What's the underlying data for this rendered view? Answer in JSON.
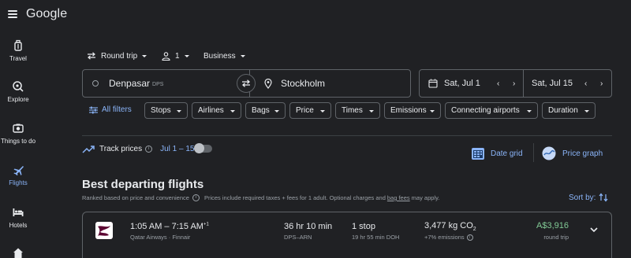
{
  "header": {
    "brand": "Google"
  },
  "nav": [
    {
      "label": "Travel",
      "icon": "suitcase-icon"
    },
    {
      "label": "Explore",
      "icon": "explore-icon"
    },
    {
      "label": "Things to do",
      "icon": "camera-icon"
    },
    {
      "label": "Flights",
      "icon": "plane-icon",
      "active": true
    },
    {
      "label": "Hotels",
      "icon": "bed-icon"
    }
  ],
  "trip": {
    "type": "Round trip",
    "passengers": "1",
    "cabin": "Business"
  },
  "search": {
    "origin": "Denpasar",
    "origin_code": "DPS",
    "destination": "Stockholm",
    "depart": "Sat, Jul 1",
    "return": "Sat, Jul 15"
  },
  "filters": {
    "all_label": "All filters",
    "chips": [
      "Stops",
      "Airlines",
      "Bags",
      "Price",
      "Times",
      "Emissions",
      "Connecting airports",
      "Duration"
    ]
  },
  "track": {
    "label": "Track prices",
    "range": "Jul 1 – 15",
    "enabled": false
  },
  "views": {
    "date_grid": "Date grid",
    "price_graph": "Price graph"
  },
  "results": {
    "heading": "Best departing flights",
    "ranked_note": "Ranked based on price and convenience",
    "price_note_pre": "Prices include required taxes + fees for 1 adult. Optional charges and",
    "price_note_link": "bag fees",
    "price_note_post": "may apply.",
    "sort_label": "Sort by:"
  },
  "flight": {
    "times": "1:05 AM – 7:15 AM",
    "day_offset": "+1",
    "carriers": "Qatar Airways · Finnair",
    "duration": "36 hr 10 min",
    "route": "DPS–ARN",
    "stops": "1 stop",
    "layover": "19 hr 55 min DOH",
    "co2": "3,477 kg CO",
    "co2_sub": "2",
    "emissions": "+7% emissions",
    "price": "A$3,916",
    "price_type": "round trip"
  },
  "colors": {
    "accent": "#8ab4f8",
    "price": "#81c995",
    "background": "#202124",
    "border": "#5f6368"
  }
}
